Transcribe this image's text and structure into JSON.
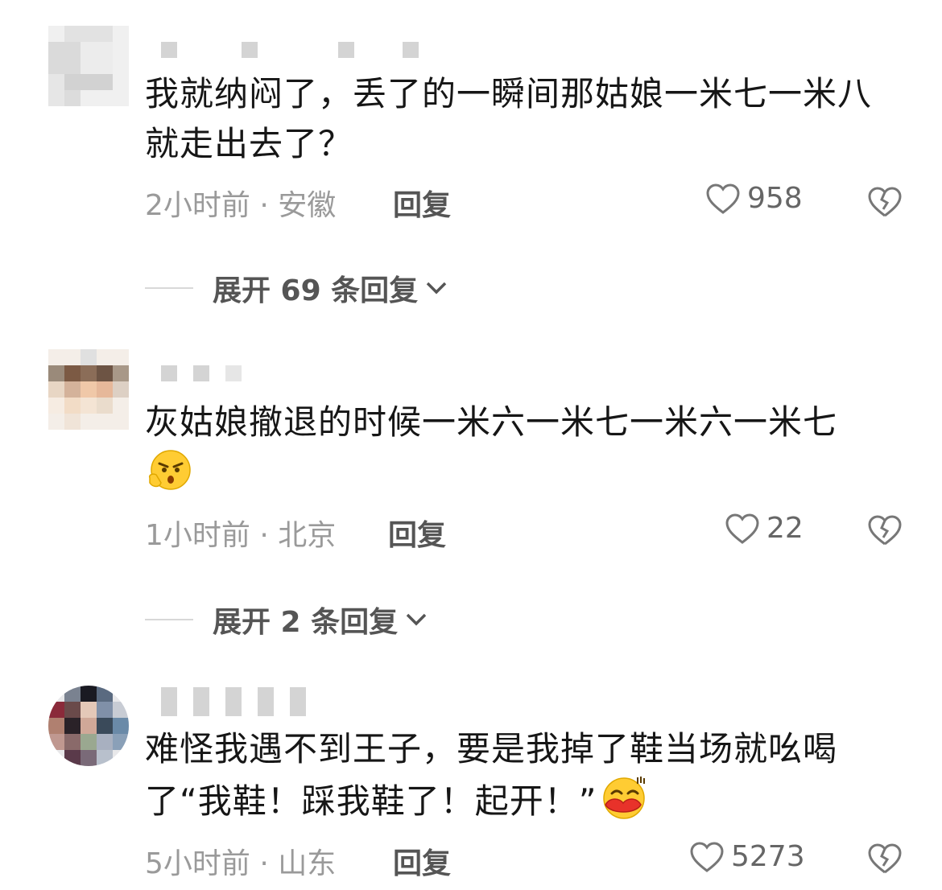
{
  "comments": [
    {
      "text": "我就纳闷了，丢了的一瞬间那姑娘一米七一米八就走出去了？",
      "meta": "2小时前 · 安徽",
      "reply": "回复",
      "likes": "958",
      "expand": "展开 69 条回复"
    },
    {
      "text": "灰姑娘撤退的时候一米六一米七一米六一米七",
      "meta": "1小时前 · 北京",
      "reply": "回复",
      "likes": "22",
      "expand": "展开 2 条回复"
    },
    {
      "text": "难怪我遇不到王子，要是我掉了鞋当场就吆喝了“我鞋！踩我鞋了！起开！”",
      "meta": "5小时前 · 山东",
      "reply": "回复",
      "likes": "5273"
    }
  ],
  "icons": {
    "like": "heart-outline-icon",
    "dislike": "broken-heart-icon",
    "expand": "chevron-down-icon",
    "emoji_1": "angry-thinking-emoji",
    "emoji_2": "kiss-lips-emoji"
  },
  "colors": {
    "text": "#161616",
    "meta": "#9a9a9a",
    "action": "#555555",
    "placeholder": "#d4d4d4"
  }
}
